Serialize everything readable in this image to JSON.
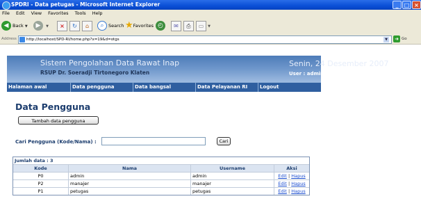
{
  "window": {
    "title": "SPDRI - Data petugas - Microsoft Internet Explorer",
    "minimize": "_",
    "maximize": "□",
    "close": "×"
  },
  "menu": [
    "File",
    "Edit",
    "View",
    "Favorites",
    "Tools",
    "Help"
  ],
  "toolbar": {
    "back_label": "Back",
    "search_label": "Search",
    "favorites_label": "Favorites"
  },
  "address": {
    "label": "Address",
    "url": "http://localhost/SPD-RI/home.php?x=19&d=otgs",
    "go_label": "Go"
  },
  "header": {
    "app_title": "Sistem Pengolahan Data Rawat Inap",
    "hospital": "RSUP Dr. Soeradji Tirtonegoro Klaten",
    "date": "Senin, 24 Desember 2007",
    "user": "User : admin"
  },
  "nav": [
    "Halaman awal",
    "Data pengguna",
    "Data bangsal",
    "Data Pelayanan RI",
    "Logout"
  ],
  "page": {
    "title": "Data Pengguna",
    "add_button": "Tambah data pengguna",
    "search_label": "Cari Pengguna (Kode/Nama) :",
    "search_value": "",
    "search_button": "Cari"
  },
  "table": {
    "count_label": "Jumlah data : 3",
    "columns": [
      "Kode",
      "Nama",
      "Username",
      "Aksi"
    ],
    "rows": [
      {
        "kode": "P0",
        "nama": "admin",
        "username": "admin"
      },
      {
        "kode": "P2",
        "nama": "manajer",
        "username": "manajer"
      },
      {
        "kode": "P1",
        "nama": "petugas",
        "username": "petugas"
      }
    ],
    "edit_label": "Edit",
    "delete_label": "Hapus",
    "separator": "|"
  },
  "colors": {
    "titlebar": "#0a4fd6",
    "header": "#6f97cb",
    "nav": "#2f5fa0",
    "heading": "#1c3d6e",
    "link": "#1a4dd0"
  }
}
